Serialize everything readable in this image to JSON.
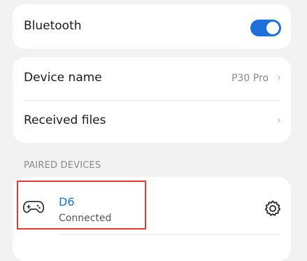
{
  "bluetooth": {
    "label": "Bluetooth",
    "enabled": true,
    "accent": "#1f6fd8"
  },
  "device": {
    "name_label": "Device name",
    "name_value": "P30 Pro",
    "received_files_label": "Received files"
  },
  "paired": {
    "section_title": "PAIRED DEVICES",
    "devices": [
      {
        "name": "D6",
        "status": "Connected",
        "icon": "gamepad-icon"
      }
    ]
  }
}
